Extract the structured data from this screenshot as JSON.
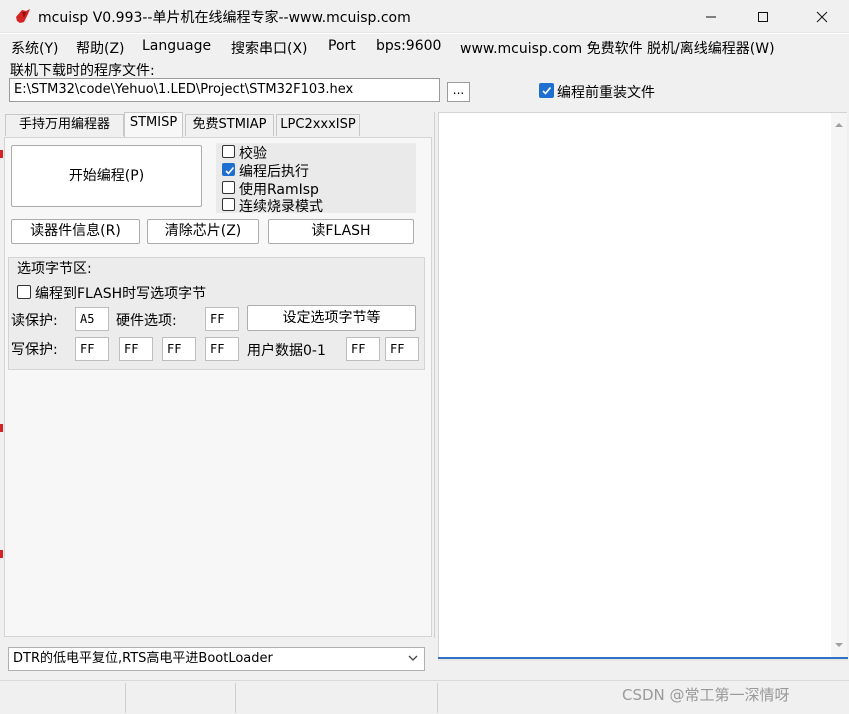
{
  "window": {
    "title": "mcuisp V0.993--单片机在线编程专家--www.mcuisp.com",
    "minimize": "—",
    "maximize": "☐",
    "close": "✕"
  },
  "menu": {
    "items": [
      "系统(Y)",
      "帮助(Z)",
      "Language",
      "搜索串口(X)",
      "Port",
      "bps:9600",
      "www.mcuisp.com 免费软件 脱机/离线编程器(W)"
    ]
  },
  "file": {
    "label": "联机下载时的程序文件:",
    "path": "E:\\STM32\\code\\Yehuo\\1.LED\\Project\\STM32F103.hex",
    "browse": "...",
    "reload_label": "编程前重装文件",
    "reload_checked": true
  },
  "tabs": [
    "手持万用编程器",
    "STMISP",
    "免费STMIAP",
    "LPC2xxxISP"
  ],
  "active_tab": "STMISP",
  "actions": {
    "start": "开始编程(P)",
    "read_info": "读器件信息(R)",
    "erase": "清除芯片(Z)",
    "read_flash": "读FLASH"
  },
  "options": [
    {
      "label": "校验",
      "checked": false
    },
    {
      "label": "编程后执行",
      "checked": true
    },
    {
      "label": "使用RamIsp",
      "checked": false
    },
    {
      "label": "连续烧录模式",
      "checked": false
    }
  ],
  "option_bytes": {
    "title": "选项字节区:",
    "write_on_flash_label": "编程到FLASH时写选项字节",
    "write_on_flash_checked": false,
    "read_protect_label": "读保护:",
    "read_protect_value": "A5",
    "hardware_label": "硬件选项:",
    "hardware_value": "FF",
    "set_button": "设定选项字节等",
    "write_protect_label": "写保护:",
    "write_protect_values": [
      "FF",
      "FF",
      "FF",
      "FF"
    ],
    "user_data_label": "用户数据0-1",
    "user_data_values": [
      "FF",
      "FF"
    ]
  },
  "mode": {
    "selected": "DTR的低电平复位,RTS高电平进BootLoader"
  },
  "watermark": "CSDN @常工第一深情呀",
  "colors": {
    "accent": "#1e6fd0",
    "progress": "#2f72c4",
    "icon_red": "#d42424"
  }
}
